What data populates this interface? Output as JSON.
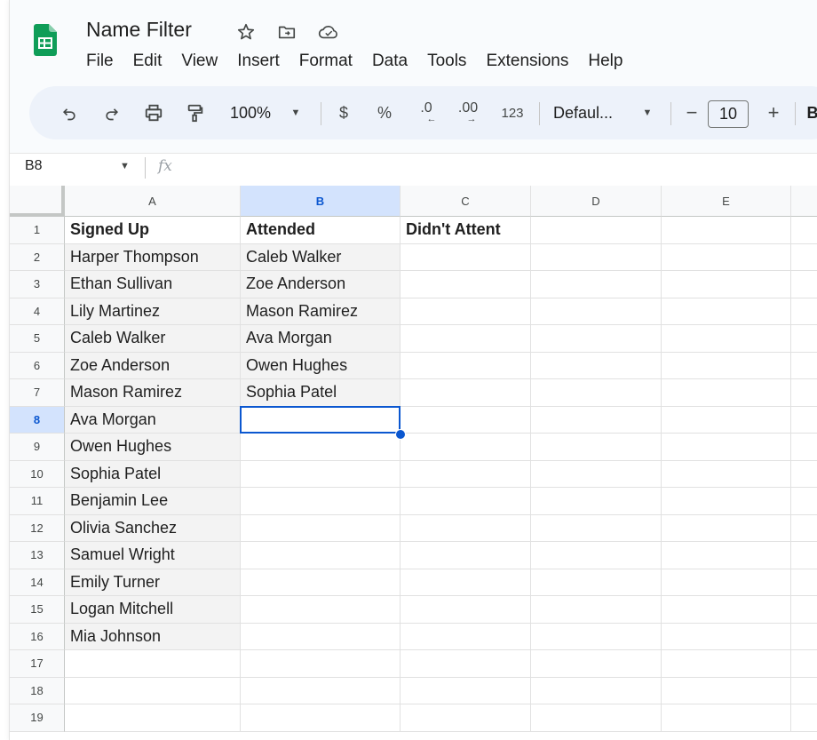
{
  "doc": {
    "title": "Name Filter"
  },
  "menu": [
    "File",
    "Edit",
    "View",
    "Insert",
    "Format",
    "Data",
    "Tools",
    "Extensions",
    "Help"
  ],
  "toolbar": {
    "zoom": "100%",
    "currency": "$",
    "percent": "%",
    "dec_decrease": ".0",
    "dec_increase": ".00",
    "number_format": "123",
    "font": "Defaul...",
    "font_size": "10",
    "minus": "−",
    "plus": "+",
    "bold": "B"
  },
  "formula": {
    "cell_ref": "B8",
    "fx": "fx"
  },
  "columns": [
    "A",
    "B",
    "C",
    "D",
    "E"
  ],
  "rows": [
    "1",
    "2",
    "3",
    "4",
    "5",
    "6",
    "7",
    "8",
    "9",
    "10",
    "11",
    "12",
    "13",
    "14",
    "15",
    "16",
    "17",
    "18",
    "19"
  ],
  "cells": {
    "A": [
      "Signed Up",
      "Harper Thompson",
      "Ethan Sullivan",
      "Lily Martinez",
      "Caleb Walker",
      "Zoe Anderson",
      "Mason Ramirez",
      "Ava Morgan",
      "Owen Hughes",
      "Sophia Patel",
      "Benjamin Lee",
      "Olivia Sanchez",
      "Samuel Wright",
      "Emily Turner",
      "Logan Mitchell",
      "Mia Johnson"
    ],
    "B": [
      "Attended",
      "Caleb Walker",
      "Zoe Anderson",
      "Mason Ramirez",
      "Ava Morgan",
      "Owen Hughes",
      "Sophia Patel"
    ],
    "C": [
      "Didn't Attent"
    ]
  },
  "selection": {
    "column": "B",
    "row": "8"
  },
  "colors": {
    "accent": "#0b57d0",
    "selected_header": "#d3e3fd",
    "toolbar_bg": "#edf2fa",
    "logo_green": "#0f9d58"
  }
}
